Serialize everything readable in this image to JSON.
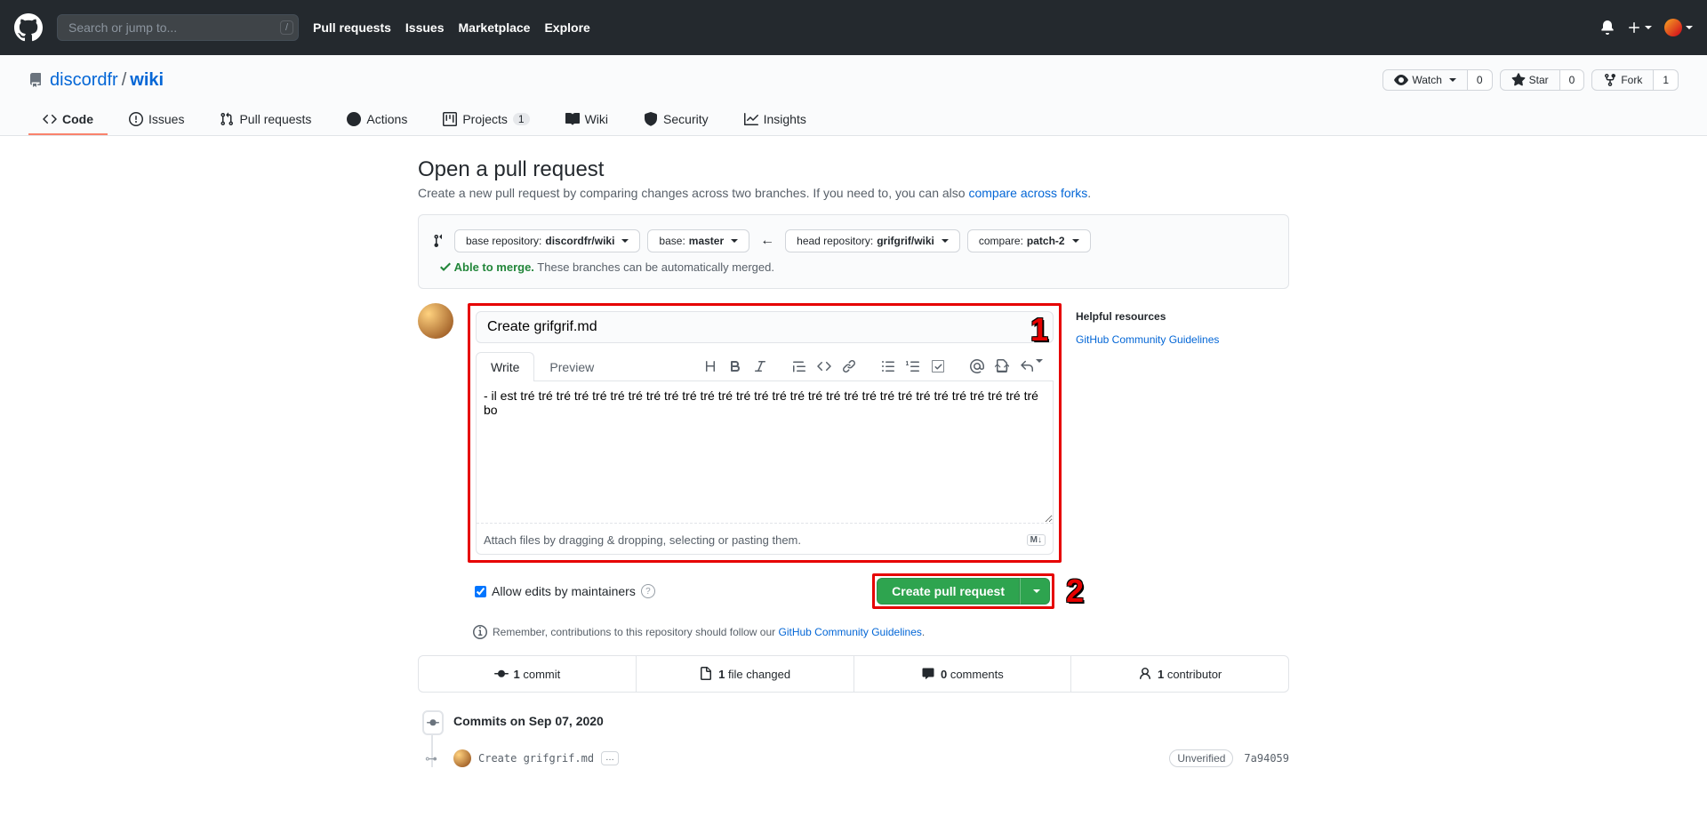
{
  "header": {
    "search_placeholder": "Search or jump to...",
    "search_key": "/",
    "nav": {
      "pull_requests": "Pull requests",
      "issues": "Issues",
      "marketplace": "Marketplace",
      "explore": "Explore"
    }
  },
  "repo": {
    "owner": "discordfr",
    "name": "wiki",
    "watch_label": "Watch",
    "watch_count": "0",
    "star_label": "Star",
    "star_count": "0",
    "fork_label": "Fork",
    "fork_count": "1"
  },
  "tabs": {
    "code": "Code",
    "issues": "Issues",
    "prs": "Pull requests",
    "actions": "Actions",
    "projects": "Projects",
    "projects_count": "1",
    "wiki": "Wiki",
    "security": "Security",
    "insights": "Insights"
  },
  "page": {
    "title": "Open a pull request",
    "subtitle_a": "Create a new pull request by comparing changes across two branches. If you need to, you can also ",
    "subtitle_link": "compare across forks",
    "subtitle_b": "."
  },
  "compare": {
    "base_repo_label": "base repository: ",
    "base_repo": "discordfr/wiki",
    "base_label": "base: ",
    "base_branch": "master",
    "head_repo_label": "head repository: ",
    "head_repo": "grifgrif/wiki",
    "compare_label": "compare: ",
    "compare_branch": "patch-2",
    "ok_label": "Able to merge.",
    "ok_msg": " These branches can be automatically merged."
  },
  "form": {
    "title_value": "Create grifgrif.md",
    "tab_write": "Write",
    "tab_preview": "Preview",
    "body_value": "- il est tré tré tré tré tré tré tré tré tré tré tré tré tré tré tré tré tré tré tré tré tré tré tré tré tré tré tré tré tré bo",
    "attach_hint": "Attach files by dragging & dropping, selecting or pasting them.",
    "md_badge": "M↓",
    "allow_edits": "Allow edits by maintainers",
    "submit": "Create pull request",
    "contrib_prefix": "Remember, contributions to this repository should follow our ",
    "contrib_link": "GitHub Community Guidelines",
    "contrib_suffix": "."
  },
  "sidebar": {
    "heading": "Helpful resources",
    "link": "GitHub Community Guidelines"
  },
  "diffstat": {
    "commits_n": "1",
    "commits_l": " commit",
    "files_n": "1",
    "files_l": " file changed",
    "comments_n": "0",
    "comments_l": " comments",
    "contrib_n": "1",
    "contrib_l": " contributor"
  },
  "timeline": {
    "date_label": "Commits on Sep 07, 2020",
    "commit_title": "Create grifgrif.md",
    "unverified": "Unverified",
    "sha": "7a94059"
  },
  "annotations": {
    "n1": "1",
    "n2": "2"
  }
}
